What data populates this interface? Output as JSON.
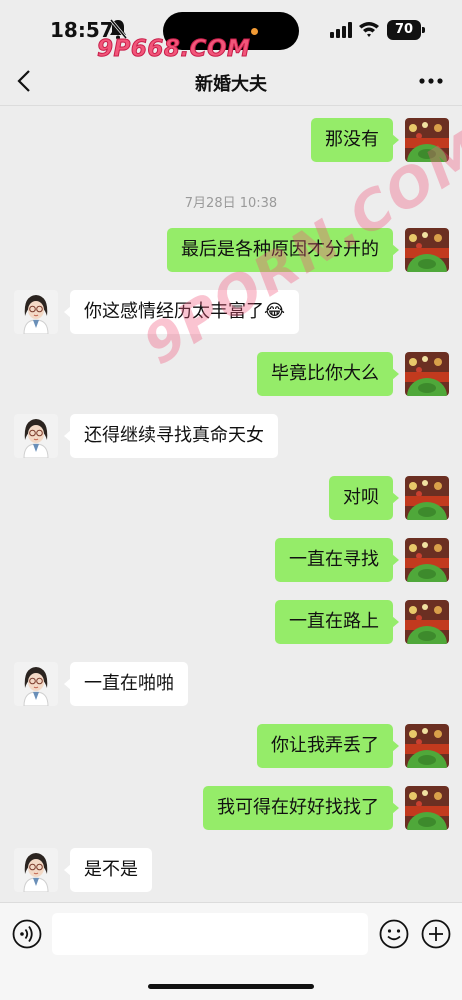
{
  "status_bar": {
    "time": "18:57",
    "battery": "70",
    "watermark": "9P668.COM"
  },
  "header": {
    "title": "新婚大夫"
  },
  "chat": {
    "timestamp": "7月28日 10:38",
    "watermark": "9PORN.COM",
    "messages": [
      {
        "sender": "me",
        "text": "那没有"
      },
      {
        "sender": "me",
        "text": "最后是各种原因才分开的"
      },
      {
        "sender": "them",
        "text": "你这感情经历太丰富了😂"
      },
      {
        "sender": "me",
        "text": "毕竟比你大么"
      },
      {
        "sender": "them",
        "text": "还得继续寻找真命天女"
      },
      {
        "sender": "me",
        "text": "对呗"
      },
      {
        "sender": "me",
        "text": "一直在寻找"
      },
      {
        "sender": "me",
        "text": "一直在路上"
      },
      {
        "sender": "them",
        "text": "一直在啪啪"
      },
      {
        "sender": "me",
        "text": "你让我弄丢了"
      },
      {
        "sender": "me",
        "text": "我可得在好好找找了"
      },
      {
        "sender": "them",
        "text": "是不是"
      }
    ]
  },
  "input_bar": {
    "placeholder": "",
    "icons": [
      "voice-icon",
      "emoji-icon",
      "plus-icon"
    ]
  },
  "colors": {
    "background": "#ededed",
    "my_bubble": "#95ec69",
    "their_bubble": "#ffffff"
  }
}
